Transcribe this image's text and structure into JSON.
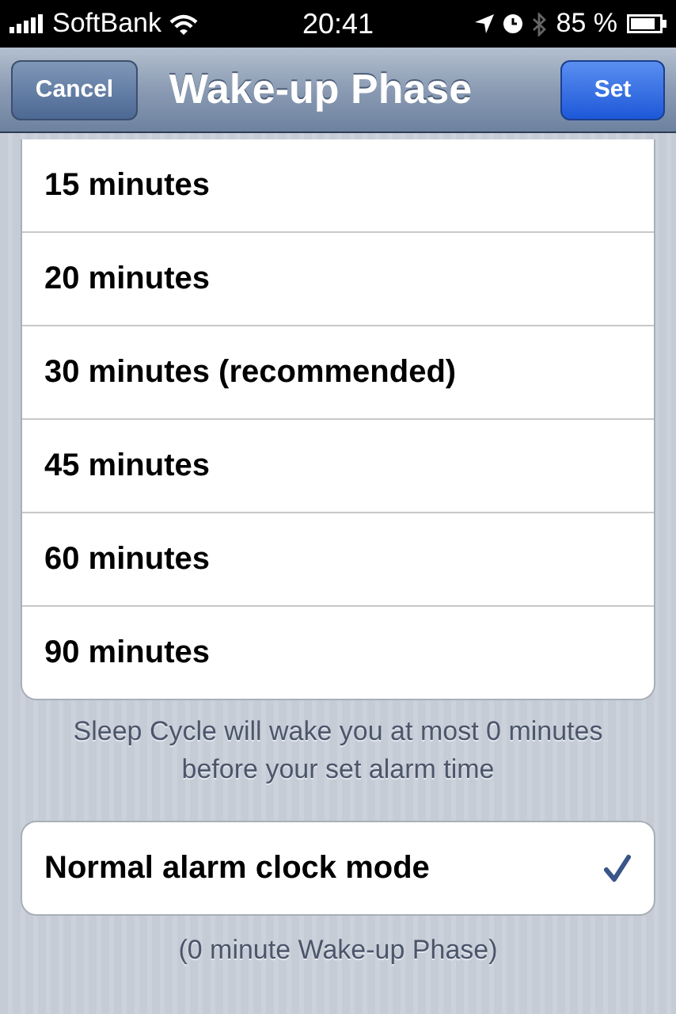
{
  "status_bar": {
    "carrier": "SoftBank",
    "time": "20:41",
    "battery": "85 %"
  },
  "nav_bar": {
    "title": "Wake-up Phase",
    "left_button": "Cancel",
    "right_button": "Set"
  },
  "phases": [
    {
      "label": "15 minutes",
      "selected": false
    },
    {
      "label": "20 minutes",
      "selected": false
    },
    {
      "label": "30 minutes (recommended)",
      "selected": false
    },
    {
      "label": "45 minutes",
      "selected": false
    },
    {
      "label": "60 minutes",
      "selected": false
    },
    {
      "label": "90 minutes",
      "selected": false
    }
  ],
  "phases_footer": "Sleep Cycle will wake you at most 0 minutes before your set alarm time",
  "normal_mode": {
    "label": "Normal alarm clock mode",
    "selected": true
  },
  "normal_footer": "(0 minute Wake-up Phase)"
}
